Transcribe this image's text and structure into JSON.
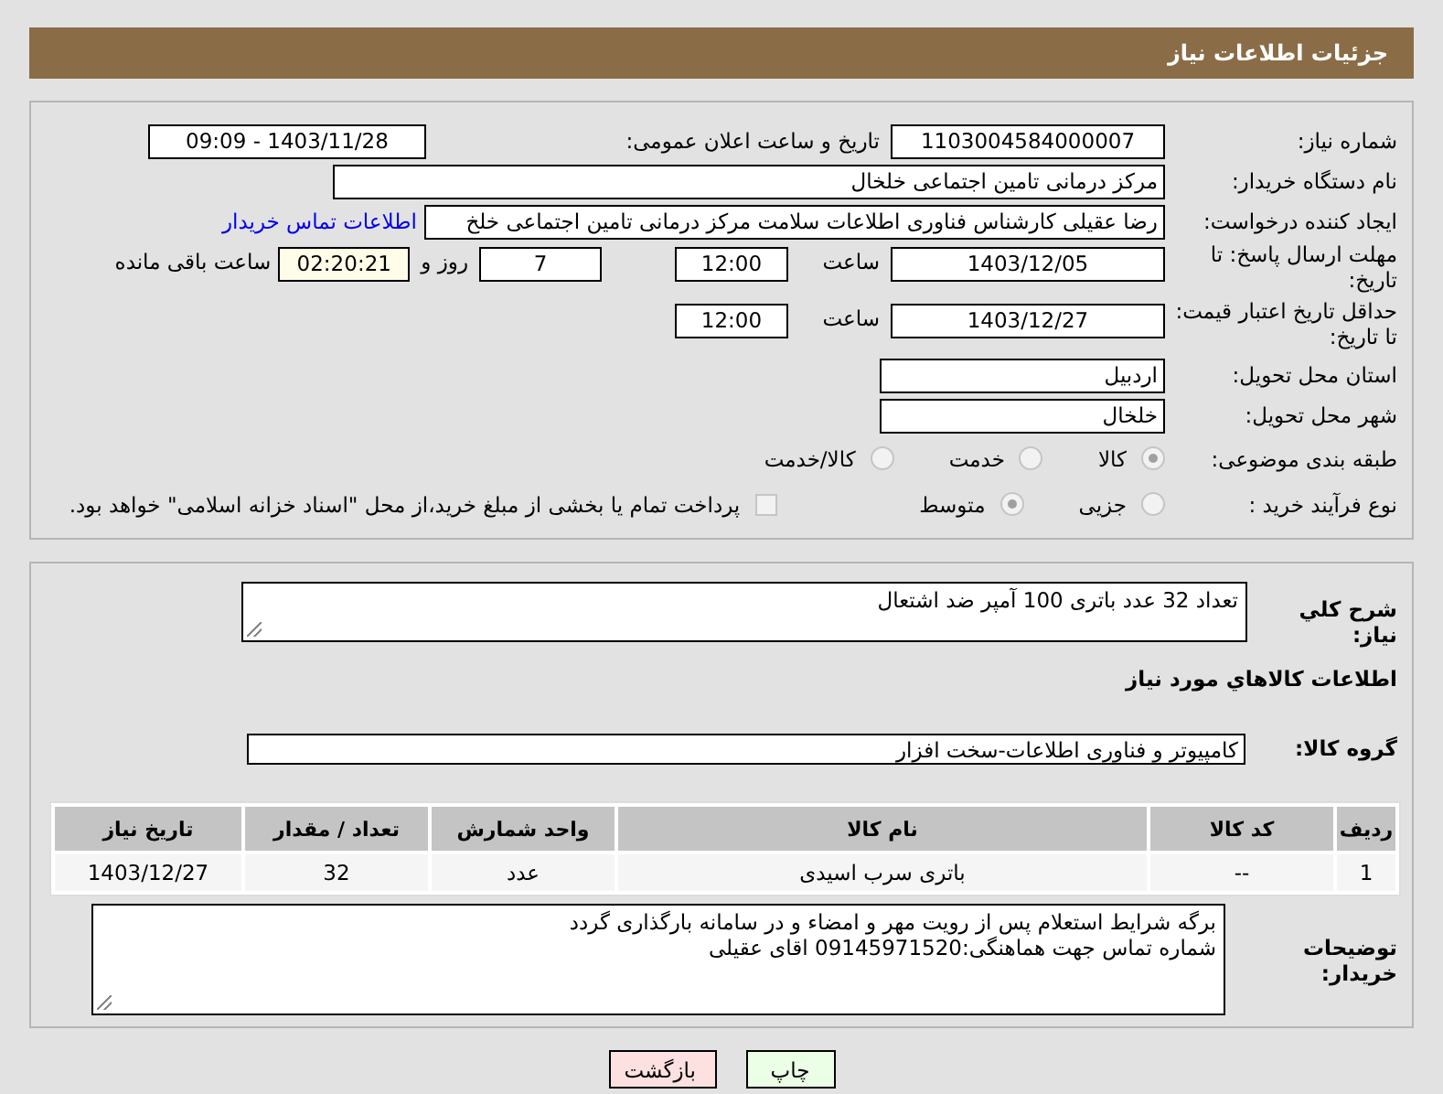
{
  "header": {
    "title": "جزئیات اطلاعات نیاز"
  },
  "need_number": {
    "label": "شماره نیاز:",
    "value": "1103004584000007"
  },
  "announce": {
    "label": "تاریخ و ساعت اعلان عمومی:",
    "value": "1403/11/28 - 09:09"
  },
  "buyer_org": {
    "label": "نام دستگاه خریدار:",
    "value": "مرکز درمانی تامین اجتماعی خلخال"
  },
  "requester": {
    "label": "ایجاد کننده درخواست:",
    "value": "رضا عقیلی کارشناس فناوری اطلاعات سلامت مرکز درمانی تامین اجتماعی خلخ",
    "link": "اطلاعات تماس خریدار"
  },
  "deadline": {
    "label": "مهلت ارسال پاسخ: تا تاریخ:",
    "date": "1403/12/05",
    "time_label": "ساعت",
    "time": "12:00",
    "days": "7",
    "days_label": "روز و",
    "remaining": "02:20:21",
    "remaining_label": "ساعت باقی مانده"
  },
  "validity": {
    "label": "حداقل تاریخ اعتبار قیمت: تا تاریخ:",
    "date": "1403/12/27",
    "time_label": "ساعت",
    "time": "12:00"
  },
  "province": {
    "label": "استان محل تحویل:",
    "value": "اردبیل"
  },
  "city": {
    "label": "شهر محل تحویل:",
    "value": "خلخال"
  },
  "category": {
    "label": "طبقه بندی موضوعی:",
    "options": [
      {
        "label": "کالا",
        "selected": true
      },
      {
        "label": "خدمت",
        "selected": false
      },
      {
        "label": "کالا/خدمت",
        "selected": false
      }
    ]
  },
  "purchase_type": {
    "label": "نوع فرآیند خرید :",
    "options": [
      {
        "label": "جزیی",
        "selected": false
      },
      {
        "label": "متوسط",
        "selected": true
      }
    ],
    "treasury": {
      "checked": false,
      "label": "پرداخت تمام یا بخشی از مبلغ خرید،از محل \"اسناد خزانه اسلامی\" خواهد بود."
    }
  },
  "description": {
    "label": "شرح کلي نیاز:",
    "value": "تعداد 32 عدد باتری 100 آمپر ضد اشتعال"
  },
  "goods_heading": "اطلاعات کالاهاي مورد نياز",
  "goods_group": {
    "label": "گروه کالا:",
    "value": "کامپیوتر و فناوری اطلاعات-سخت افزار"
  },
  "table": {
    "columns": [
      "ردیف",
      "کد کالا",
      "نام کالا",
      "واحد شمارش",
      "تعداد / مقدار",
      "تاریخ نیاز"
    ],
    "rows": [
      [
        "1",
        "--",
        "باتری سرب اسیدی",
        "عدد",
        "32",
        "1403/12/27"
      ]
    ]
  },
  "buyer_notes": {
    "label": "توضیحات خریدار:",
    "lines": [
      "برگه شرایط استعلام پس از رویت مهر و امضاء و در سامانه بارگذاری گردد",
      "شماره تماس جهت هماهنگی:09145971520 اقای عقیلی"
    ]
  },
  "buttons": [
    {
      "kind": "print",
      "label": "چاپ"
    },
    {
      "kind": "back",
      "label": "بازگشت"
    }
  ]
}
